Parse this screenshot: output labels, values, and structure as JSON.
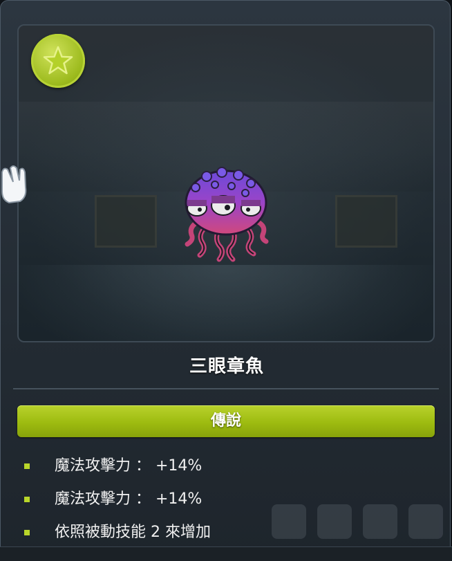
{
  "monster": {
    "name": "三眼章魚"
  },
  "grade": {
    "label": "傳說",
    "icon": "star-badge-icon",
    "color": "#9dbb10"
  },
  "options": [
    {
      "text": "魔法攻擊力 ： +14%"
    },
    {
      "text": "魔法攻擊力 ： +14%"
    },
    {
      "text": "依照被動技能 2 來增加"
    }
  ],
  "colors": {
    "accent": "#9dbb10",
    "bullet": "#b9d62a",
    "panel_bg": "#232b33"
  }
}
